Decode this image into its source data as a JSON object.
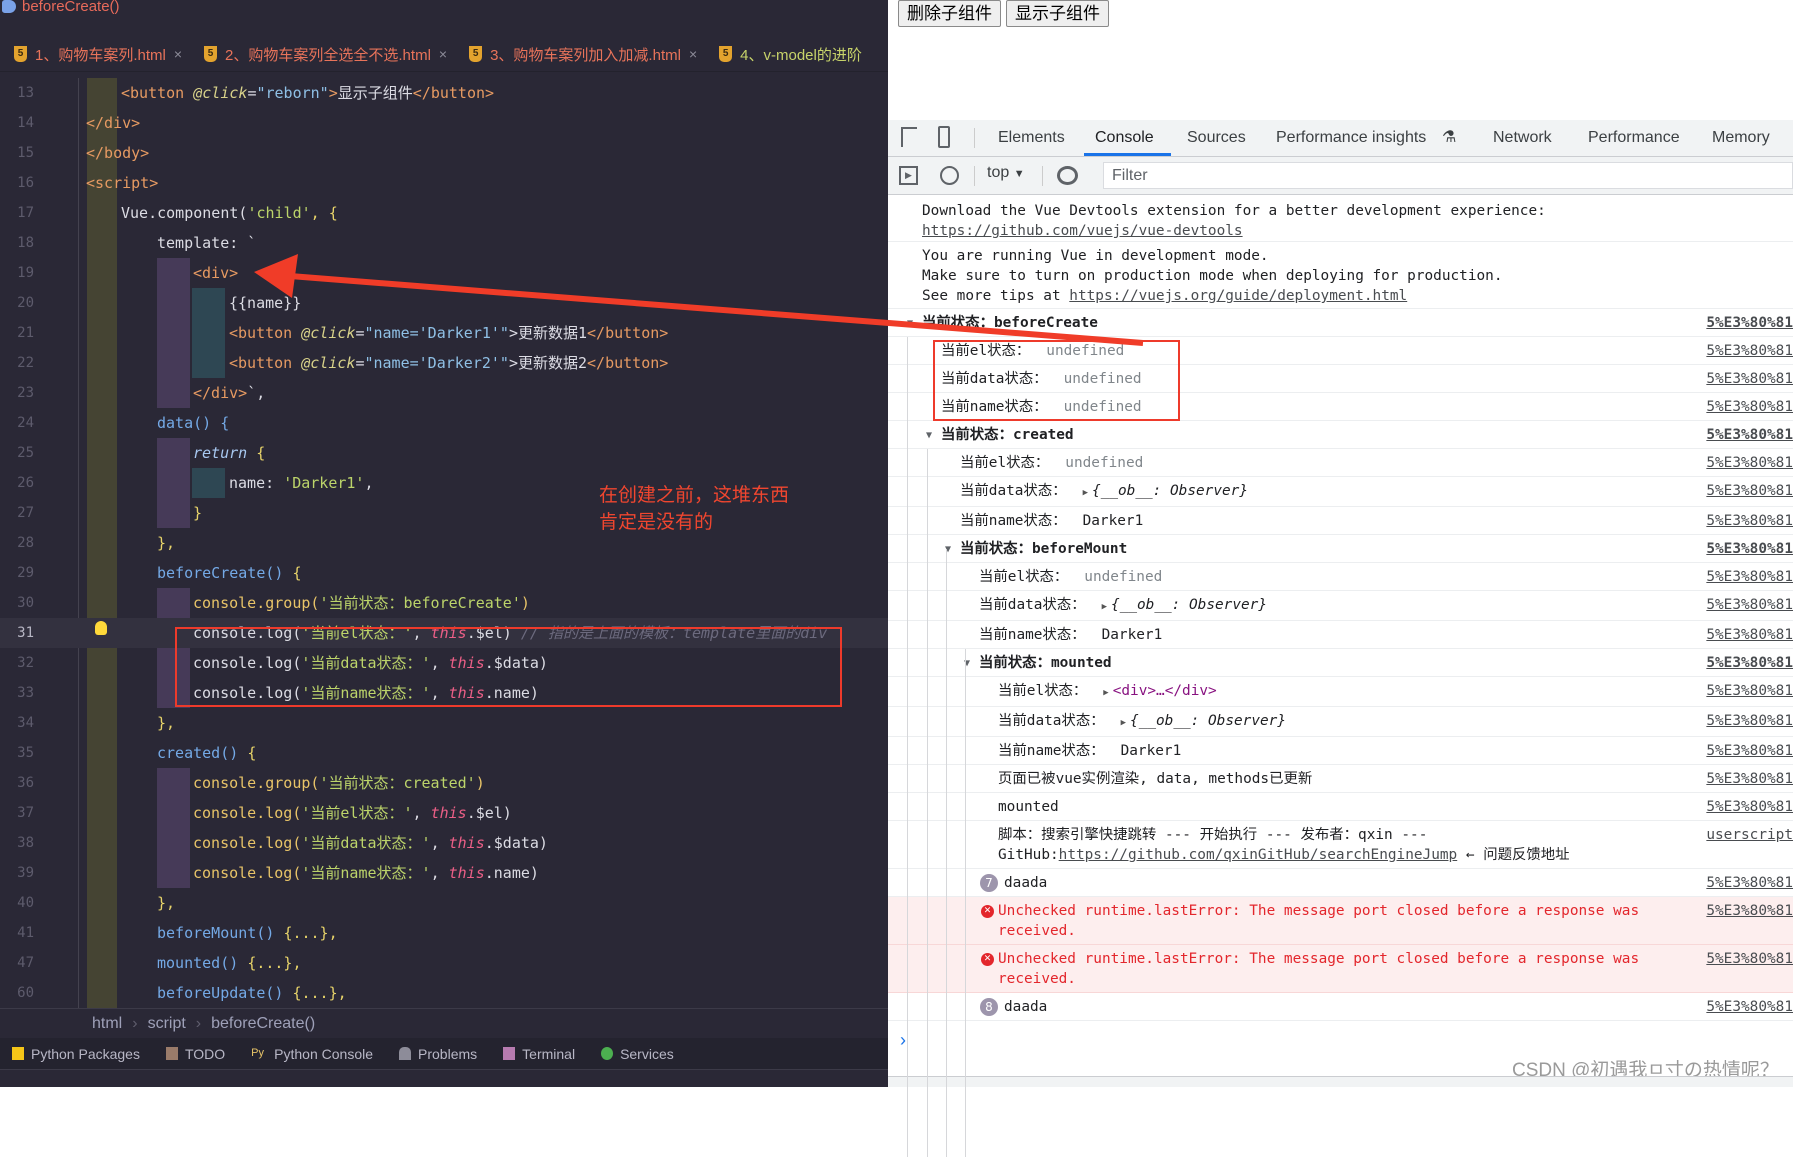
{
  "editor": {
    "breadcrumb_top": "beforeCreate()",
    "tabs": [
      {
        "label": "1、购物车案列.html"
      },
      {
        "label": "2、购物车案列全选全不选.html"
      },
      {
        "label": "3、购物车案列加入加减.html"
      },
      {
        "label": "4、v-model的进阶"
      }
    ],
    "tab_close": "×",
    "lines": [
      {
        "n": "13",
        "indent": 121,
        "t": [
          [
            "<button ",
            "tag"
          ],
          [
            "@click",
            "attr"
          ],
          [
            "=",
            "pl"
          ],
          [
            "\"reborn\"",
            "str"
          ],
          [
            ">",
            "tag"
          ],
          [
            "显示子组件",
            "pl"
          ],
          [
            "</button>",
            "tag"
          ]
        ]
      },
      {
        "n": "14",
        "indent": 86,
        "t": [
          [
            "</div>",
            "tag"
          ]
        ]
      },
      {
        "n": "15",
        "indent": 86,
        "t": [
          [
            "</body>",
            "tag"
          ]
        ]
      },
      {
        "n": "16",
        "indent": 86,
        "t": [
          [
            "<script>",
            "tag"
          ]
        ]
      },
      {
        "n": "17",
        "indent": 121,
        "t": [
          [
            "Vue.component(",
            "pl"
          ],
          [
            "'child'",
            "val"
          ],
          [
            ", {",
            "br"
          ]
        ]
      },
      {
        "n": "18",
        "indent": 157,
        "t": [
          [
            "template: `",
            "pl"
          ]
        ]
      },
      {
        "n": "19",
        "indent": 193,
        "t": [
          [
            "<div>",
            "tag"
          ]
        ]
      },
      {
        "n": "20",
        "indent": 229,
        "t": [
          [
            "{{name}}",
            "pl"
          ]
        ]
      },
      {
        "n": "21",
        "indent": 229,
        "t": [
          [
            "<button ",
            "tag"
          ],
          [
            "@click",
            "attr"
          ],
          [
            "=",
            "pl"
          ],
          [
            "\"name='Darker1'\"",
            "str"
          ],
          [
            ">更新数据1",
            "pl"
          ],
          [
            "</button>",
            "tag"
          ]
        ]
      },
      {
        "n": "22",
        "indent": 229,
        "t": [
          [
            "<button ",
            "tag"
          ],
          [
            "@click",
            "attr"
          ],
          [
            "=",
            "pl"
          ],
          [
            "\"name='Darker2'\"",
            "str"
          ],
          [
            ">更新数据2",
            "pl"
          ],
          [
            "</button>",
            "tag"
          ]
        ]
      },
      {
        "n": "23",
        "indent": 193,
        "t": [
          [
            "</div>",
            "tag"
          ],
          [
            "`,",
            "pl"
          ]
        ]
      },
      {
        "n": "24",
        "indent": 157,
        "t": [
          [
            "data() {",
            "fn"
          ]
        ]
      },
      {
        "n": "25",
        "indent": 193,
        "t": [
          [
            "return",
            "ret"
          ],
          [
            " {",
            "br"
          ]
        ]
      },
      {
        "n": "26",
        "indent": 229,
        "t": [
          [
            "name: ",
            "pl"
          ],
          [
            "'Darker1'",
            "val"
          ],
          [
            ",",
            "pl"
          ]
        ]
      },
      {
        "n": "27",
        "indent": 193,
        "t": [
          [
            "}",
            "br"
          ]
        ]
      },
      {
        "n": "28",
        "indent": 157,
        "t": [
          [
            "},",
            "br"
          ]
        ]
      },
      {
        "n": "29",
        "indent": 157,
        "t": [
          [
            "beforeCreate() ",
            "fn"
          ],
          [
            "{",
            "br"
          ]
        ]
      },
      {
        "n": "30",
        "indent": 193,
        "t": [
          [
            "console.group(",
            "grp"
          ],
          [
            "'当前状态：beforeCreate'",
            "val"
          ],
          [
            ")",
            "grp"
          ]
        ]
      },
      {
        "n": "31",
        "indent": 193,
        "cur": true,
        "t": [
          [
            "console.log(",
            "pl"
          ],
          [
            "'当前el状态：'",
            "val"
          ],
          [
            ", ",
            "pl"
          ],
          [
            "this",
            "kw"
          ],
          [
            ".$el)",
            "pl"
          ],
          [
            " // 指的是上面的模板：template里面的div",
            "cmt"
          ]
        ]
      },
      {
        "n": "32",
        "indent": 193,
        "t": [
          [
            "console.log(",
            "pl"
          ],
          [
            "'当前data状态：'",
            "val"
          ],
          [
            ", ",
            "pl"
          ],
          [
            "this",
            "kw"
          ],
          [
            ".$data)",
            "pl"
          ]
        ]
      },
      {
        "n": "33",
        "indent": 193,
        "t": [
          [
            "console.log(",
            "pl"
          ],
          [
            "'当前name状态：'",
            "val"
          ],
          [
            ", ",
            "pl"
          ],
          [
            "this",
            "kw"
          ],
          [
            ".name)",
            "pl"
          ]
        ]
      },
      {
        "n": "34",
        "indent": 157,
        "t": [
          [
            "},",
            "br"
          ]
        ]
      },
      {
        "n": "35",
        "indent": 157,
        "t": [
          [
            "created() ",
            "fn"
          ],
          [
            "{",
            "br"
          ]
        ]
      },
      {
        "n": "36",
        "indent": 193,
        "t": [
          [
            "console.group(",
            "grp"
          ],
          [
            "'当前状态：created'",
            "val"
          ],
          [
            ")",
            "grp"
          ]
        ]
      },
      {
        "n": "37",
        "indent": 193,
        "t": [
          [
            "console.log(",
            "grp"
          ],
          [
            "'当前el状态：'",
            "val"
          ],
          [
            ", ",
            "pl"
          ],
          [
            "this",
            "kw"
          ],
          [
            ".$el)",
            "pl"
          ]
        ]
      },
      {
        "n": "38",
        "indent": 193,
        "t": [
          [
            "console.log(",
            "grp"
          ],
          [
            "'当前data状态：'",
            "val"
          ],
          [
            ", ",
            "pl"
          ],
          [
            "this",
            "kw"
          ],
          [
            ".$data)",
            "pl"
          ]
        ]
      },
      {
        "n": "39",
        "indent": 193,
        "t": [
          [
            "console.log(",
            "grp"
          ],
          [
            "'当前name状态：'",
            "val"
          ],
          [
            ", ",
            "pl"
          ],
          [
            "this",
            "kw"
          ],
          [
            ".name)",
            "pl"
          ]
        ]
      },
      {
        "n": "40",
        "indent": 157,
        "t": [
          [
            "},",
            "br"
          ]
        ]
      },
      {
        "n": "41",
        "indent": 157,
        "t": [
          [
            "beforeMount() ",
            "fn"
          ],
          [
            "{...},",
            "br"
          ]
        ]
      },
      {
        "n": "47",
        "indent": 157,
        "t": [
          [
            "mounted() ",
            "fn"
          ],
          [
            "{...},",
            "br"
          ]
        ]
      },
      {
        "n": "60",
        "indent": 157,
        "t": [
          [
            "beforeUpdate() ",
            "fn"
          ],
          [
            "{...},",
            "br"
          ]
        ]
      }
    ],
    "annotation": [
      "在创建之前，这堆东西",
      "肯定是没有的"
    ],
    "breadcrumb": [
      "html",
      "script",
      "beforeCreate()"
    ],
    "toolwindows": [
      "Python Packages",
      "TODO",
      "Python Console",
      "Problems",
      "Terminal",
      "Services"
    ]
  },
  "page": {
    "buttons": [
      "删除子组件",
      "显示子组件"
    ]
  },
  "devtools": {
    "tabs": [
      "Elements",
      "Console",
      "Sources",
      "Performance insights",
      "Network",
      "Performance",
      "Memory"
    ],
    "active_tab": "Console",
    "context": "top",
    "filter_placeholder": "Filter",
    "messages": {
      "devtools_line": "Download the Vue Devtools extension for a better development experience:",
      "devtools_link": "https://github.com/vuejs/vue-devtools",
      "dev_mode_1": "You are running Vue in development mode.",
      "dev_mode_2": "Make sure to turn on production mode when deploying for production.",
      "dev_mode_3": "See more tips at ",
      "dev_mode_link": "https://vuejs.org/guide/deployment.html"
    },
    "rows": [
      {
        "kind": "group",
        "level": 0,
        "label": "当前状态：beforeCreate",
        "src": "5%E3%80%81"
      },
      {
        "kind": "log",
        "level": 1,
        "label": "当前el状态：",
        "value": "undefined",
        "vt": "undef",
        "src": "5%E3%80%81"
      },
      {
        "kind": "log",
        "level": 1,
        "label": "当前data状态：",
        "value": "undefined",
        "vt": "undef",
        "src": "5%E3%80%81"
      },
      {
        "kind": "log",
        "level": 1,
        "label": "当前name状态：",
        "value": "undefined",
        "vt": "undef",
        "src": "5%E3%80%81"
      },
      {
        "kind": "group",
        "level": 1,
        "label": "当前状态：created",
        "src": "5%E3%80%81"
      },
      {
        "kind": "log",
        "level": 2,
        "label": "当前el状态：",
        "value": "undefined",
        "vt": "undef",
        "src": "5%E3%80%81"
      },
      {
        "kind": "log",
        "level": 2,
        "label": "当前data状态：",
        "value": "{__ob__: Observer}",
        "vt": "obj",
        "src": "5%E3%80%81"
      },
      {
        "kind": "log",
        "level": 2,
        "label": "当前name状态：",
        "value": "Darker1",
        "vt": "str",
        "src": "5%E3%80%81"
      },
      {
        "kind": "group",
        "level": 2,
        "label": "当前状态：beforeMount",
        "src": "5%E3%80%81"
      },
      {
        "kind": "log",
        "level": 3,
        "label": "当前el状态：",
        "value": "undefined",
        "vt": "undef",
        "src": "5%E3%80%81"
      },
      {
        "kind": "log",
        "level": 3,
        "label": "当前data状态：",
        "value": "{__ob__: Observer}",
        "vt": "obj",
        "src": "5%E3%80%81"
      },
      {
        "kind": "log",
        "level": 3,
        "label": "当前name状态：",
        "value": "Darker1",
        "vt": "str",
        "src": "5%E3%80%81"
      },
      {
        "kind": "group",
        "level": 3,
        "label": "当前状态：mounted",
        "src": "5%E3%80%81"
      },
      {
        "kind": "log",
        "level": 4,
        "label": "当前el状态：",
        "value": "<div>…</div>",
        "vt": "el",
        "src": "5%E3%80%81"
      },
      {
        "kind": "log",
        "level": 4,
        "label": "当前data状态：",
        "value": "{__ob__: Observer}",
        "vt": "obj",
        "src": "5%E3%80%81"
      },
      {
        "kind": "log",
        "level": 4,
        "label": "当前name状态：",
        "value": "Darker1",
        "vt": "str",
        "src": "5%E3%80%81"
      },
      {
        "kind": "log",
        "level": 4,
        "label": "页面已被vue实例渲染, data, methods已更新",
        "src": "5%E3%80%81"
      },
      {
        "kind": "log",
        "level": 4,
        "label": "mounted",
        "src": "5%E3%80%81"
      },
      {
        "kind": "script",
        "level": 4,
        "label": "脚本：搜索引擎快捷跳转 --- 开始执行 --- 发布者：qxin --- GitHub:",
        "link": "https://github.com/qxinGitHub/searchEngineJump",
        "after": " ← 问题反馈地址",
        "src": "userscript"
      },
      {
        "kind": "repeat",
        "level": 4,
        "count": "7",
        "label": "daada",
        "src": "5%E3%80%81"
      },
      {
        "kind": "error",
        "level": 4,
        "label": "Unchecked runtime.lastError: The message port closed before a response was received.",
        "src": "5%E3%80%81"
      },
      {
        "kind": "error",
        "level": 4,
        "label": "Unchecked runtime.lastError: The message port closed before a response was received.",
        "src": "5%E3%80%81"
      },
      {
        "kind": "repeat",
        "level": 4,
        "count": "8",
        "label": "daada",
        "src": "5%E3%80%81"
      }
    ],
    "prompt": "›"
  },
  "watermark": "CSDN @初遇我ㅁ寸の热情呢？",
  "colors": {
    "annotation_red": "#ee3a2b",
    "devtools_accent": "#1a73e8",
    "error_red": "#e3262c"
  }
}
